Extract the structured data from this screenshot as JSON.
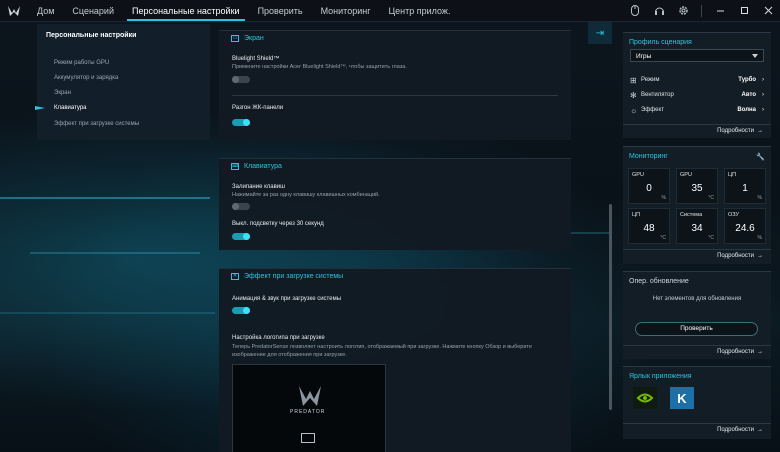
{
  "nav": {
    "tabs": [
      "Дом",
      "Сценарий",
      "Персональные настройки",
      "Проверить",
      "Мониторинг",
      "Центр прилож."
    ],
    "active_tab": "Персональные настройки",
    "window_controls": [
      "mouse-icon",
      "headset-icon",
      "gear-icon",
      "minimize-icon",
      "maximize-icon",
      "close-icon"
    ]
  },
  "left": {
    "title": "Персональные настройки",
    "items": [
      "Режим работы GPU",
      "Аккумулятор и зарядка",
      "Экран",
      "Клавиатура",
      "Эффект при загрузке системы"
    ],
    "active": "Клавиатура"
  },
  "screen": {
    "header": "Экран",
    "bluelight_title": "Bluelight Shield™",
    "bluelight_desc": "Примените настройки Acer Bluelight Shield™, чтобы защитить глаза.",
    "bluelight_on": false,
    "overdrive_title": "Разгон ЖК-панели",
    "overdrive_on": true
  },
  "keyboard": {
    "header": "Клавиатура",
    "sticky_title": "Залипание клавиш",
    "sticky_desc": "Нажимайте за раз одну клавишу клавишных комбинаций.",
    "sticky_on": false,
    "backlight_title": "Выкл. подсветку через 30 секунд",
    "backlight_on": true
  },
  "boot": {
    "header": "Эффект при загрузке системы",
    "anim_title": "Анимация & звук при загрузке системы",
    "anim_on": true,
    "logo_title": "Настройка логотипа при загрузке",
    "logo_desc": "Теперь PredatorSense позволяет настроить логотип, отображаемый при загрузке. Нажмите кнопку Обзор и выберите изображение для отображения при загрузке.",
    "logo_brand": "PREDATOR"
  },
  "profile": {
    "title": "Профиль сценария",
    "selected": "Игры",
    "rows": [
      {
        "icon": "mode-icon",
        "label": "Режим",
        "value": "Турбо"
      },
      {
        "icon": "fan-icon",
        "label": "Вентилятор",
        "value": "Авто"
      },
      {
        "icon": "effect-icon",
        "label": "Эффект",
        "value": "Волна"
      }
    ],
    "more": "Подробности"
  },
  "monitor": {
    "title": "Мониторинг",
    "tiles": [
      {
        "label": "GPU",
        "value": "0",
        "unit": "%"
      },
      {
        "label": "GPU",
        "value": "35",
        "unit": "°C"
      },
      {
        "label": "ЦП",
        "value": "1",
        "unit": "%"
      },
      {
        "label": "ЦП",
        "value": "48",
        "unit": "°C"
      },
      {
        "label": "Система",
        "value": "34",
        "unit": "°C"
      },
      {
        "label": "ОЗУ",
        "value": "24.6",
        "unit": "%"
      }
    ],
    "more": "Подробности"
  },
  "update": {
    "title": "Опер. обновление",
    "empty": "Нет элементов для обновления",
    "button": "Проверить",
    "more": "Подробности"
  },
  "shortcuts": {
    "title": "Ярлык приложения",
    "apps": [
      "nvidia-icon",
      "k-app-icon"
    ],
    "more": "Подробности"
  },
  "colors": {
    "accent": "#29c5de",
    "toggle_on": "#1a9db3"
  }
}
